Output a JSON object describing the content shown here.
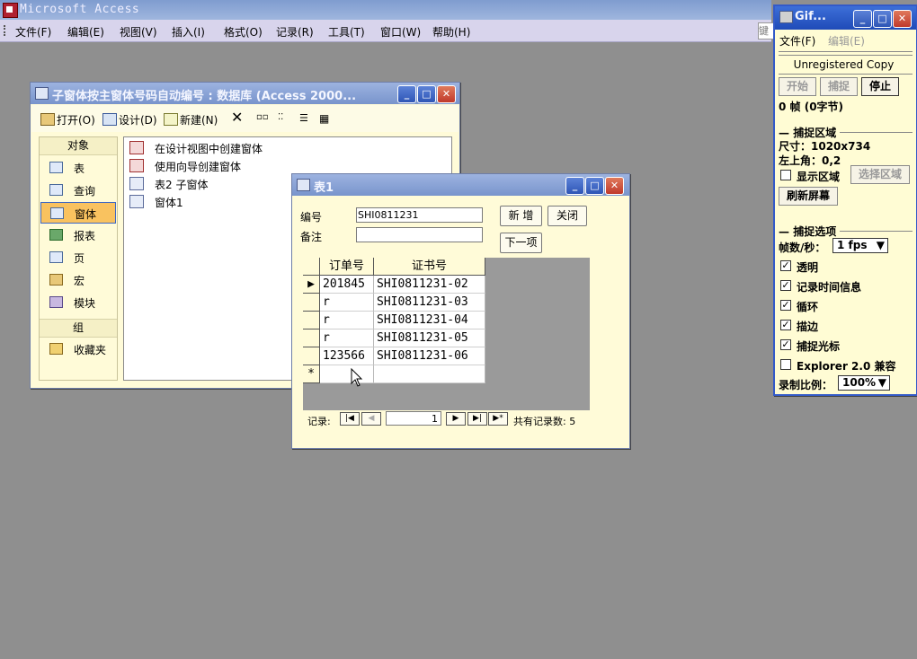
{
  "app": {
    "title": "Microsoft Access"
  },
  "menubar": {
    "items": [
      "文件(F)",
      "编辑(E)",
      "视图(V)",
      "插入(I)",
      "格式(O)",
      "记录(R)",
      "工具(T)",
      "窗口(W)",
      "帮助(H)"
    ],
    "help_box": "键"
  },
  "dbwindow": {
    "title": "子窗体按主窗体号码自动编号 : 数据库 (Access 2000...",
    "toolbar": {
      "open": "打开(O)",
      "design": "设计(D)",
      "new": "新建(N)"
    },
    "objects_header": "对象",
    "objects": [
      "表",
      "查询",
      "窗体",
      "报表",
      "页",
      "宏",
      "模块"
    ],
    "groups_header": "组",
    "groups": [
      "收藏夹"
    ],
    "list_items": [
      "在设计视图中创建窗体",
      "使用向导创建窗体",
      "表2 子窗体",
      "窗体1"
    ]
  },
  "formwin": {
    "title": "表1",
    "fields": {
      "number_label": "编号",
      "number_value": "SHI0811231",
      "note_label": "备注",
      "note_value": ""
    },
    "buttons": {
      "new": "新 增",
      "close": "关闭",
      "next": "下一项"
    },
    "grid": {
      "columns": [
        "订单号",
        "证书号"
      ],
      "rows": [
        [
          "201845",
          "SHI0811231-02"
        ],
        [
          "r",
          "SHI0811231-03"
        ],
        [
          "r",
          "SHI0811231-04"
        ],
        [
          "r",
          "SHI0811231-05"
        ],
        [
          "123566",
          "SHI0811231-06"
        ]
      ],
      "new_row_marker": "*"
    },
    "nav": {
      "label": "记录:",
      "current": "1",
      "total": "共有记录数: 5"
    }
  },
  "gifpanel": {
    "title": "Gif...",
    "menu": {
      "file": "文件(F)",
      "edit": "编辑(E)"
    },
    "unregistered": "Unregistered Copy",
    "buttons": {
      "start": "开始",
      "capture": "捕捉",
      "stop": "停止"
    },
    "frames": "0 帧 (0字节)",
    "capture_area_header": "捕捉区域",
    "size": "尺寸：1020x734",
    "top_left": "左上角：0,2",
    "show_area": "显示区域",
    "select_area": "选择区域",
    "refresh": "刷新屏幕",
    "capture_options_header": "捕捉选项",
    "fps_label": "帧数/秒：",
    "fps_value": "1 fps",
    "options": [
      {
        "label": "透明",
        "checked": true
      },
      {
        "label": "记录时间信息",
        "checked": true
      },
      {
        "label": "循环",
        "checked": true
      },
      {
        "label": "描边",
        "checked": true
      },
      {
        "label": "捕捉光标",
        "checked": true
      },
      {
        "label": "Explorer 2.0 兼容",
        "checked": false
      }
    ],
    "scale_label": "录制比例：",
    "scale_value": "100%"
  }
}
